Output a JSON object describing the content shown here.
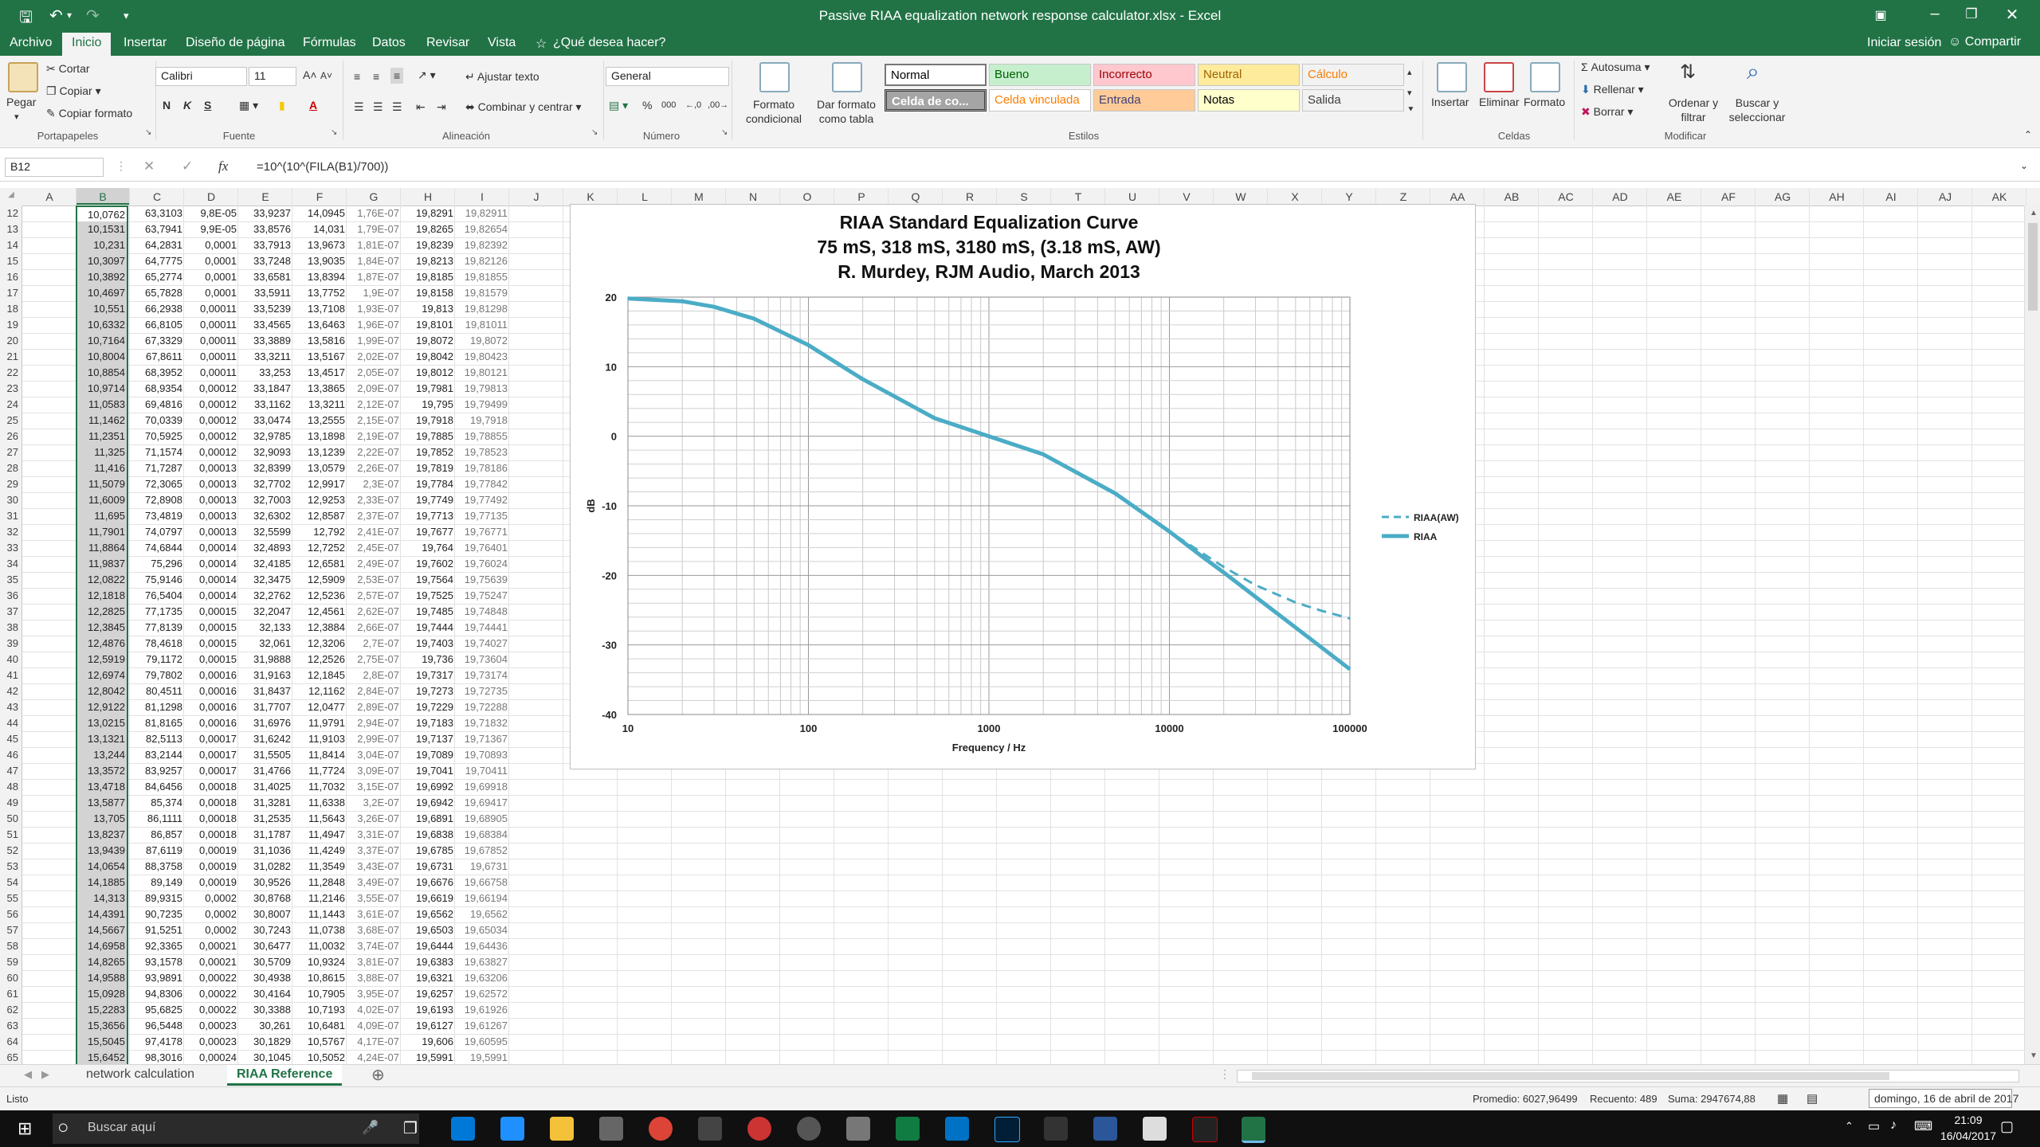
{
  "window": {
    "title": "Passive RIAA equalization network response calculator.xlsx - Excel"
  },
  "tabs": [
    "Archivo",
    "Inicio",
    "Insertar",
    "Diseño de página",
    "Fórmulas",
    "Datos",
    "Revisar",
    "Vista"
  ],
  "tell_me": "¿Qué desea hacer?",
  "account": {
    "signin": "Iniciar sesión",
    "share": "Compartir"
  },
  "ribbon": {
    "clipboard": {
      "paste": "Pegar",
      "cut": "Cortar",
      "copy": "Copiar",
      "format_painter": "Copiar formato",
      "group": "Portapapeles"
    },
    "font": {
      "name": "Calibri",
      "size": "11",
      "group": "Fuente"
    },
    "alignment": {
      "wrap": "Ajustar texto",
      "merge": "Combinar y centrar",
      "group": "Alineación"
    },
    "number": {
      "format": "General",
      "group": "Número"
    },
    "styles": {
      "cond_format": "Formato condicional",
      "as_table": "Dar formato como tabla",
      "group": "Estilos",
      "cells": [
        {
          "label": "Normal",
          "bg": "#ffffff",
          "fg": "#000000"
        },
        {
          "label": "Bueno",
          "bg": "#c6efce",
          "fg": "#006100"
        },
        {
          "label": "Incorrecto",
          "bg": "#ffc7ce",
          "fg": "#9c0006"
        },
        {
          "label": "Neutral",
          "bg": "#ffeb9c",
          "fg": "#9c6500"
        },
        {
          "label": "Cálculo",
          "bg": "#f2f2f2",
          "fg": "#fa7d00"
        },
        {
          "label": "Celda de co...",
          "bg": "#a5a5a5",
          "fg": "#ffffff"
        },
        {
          "label": "Celda vinculada",
          "bg": "#ffffff",
          "fg": "#fa7d00"
        },
        {
          "label": "Entrada",
          "bg": "#ffcc99",
          "fg": "#3f3f76"
        },
        {
          "label": "Notas",
          "bg": "#ffffcc",
          "fg": "#000000"
        },
        {
          "label": "Salida",
          "bg": "#f2f2f2",
          "fg": "#3f3f3f"
        }
      ]
    },
    "cells": {
      "insert": "Insertar",
      "delete": "Eliminar",
      "format": "Formato",
      "group": "Celdas"
    },
    "editing": {
      "autosum": "Autosuma",
      "fill": "Rellenar",
      "clear": "Borrar",
      "sort": "Ordenar y filtrar",
      "find": "Buscar y seleccionar",
      "group": "Modificar"
    }
  },
  "formula_bar": {
    "name_box": "B12",
    "fx": "fx",
    "formula": "=10^(10^(FILA(B1)/700))"
  },
  "columns": [
    "A",
    "B",
    "C",
    "D",
    "E",
    "F",
    "G",
    "H",
    "I",
    "J",
    "K",
    "L",
    "M",
    "N",
    "O",
    "P",
    "Q",
    "R",
    "S",
    "T",
    "U",
    "V",
    "W",
    "X",
    "Y",
    "Z",
    "AA",
    "AB",
    "AC",
    "AD",
    "AE",
    "AF",
    "AG",
    "AH",
    "AI",
    "AJ",
    "AK"
  ],
  "rows": [
    {
      "n": "12",
      "c": [
        "10,0762",
        "63,3103",
        "9,8E-05",
        "33,9237",
        "14,0945",
        "1,76E-07",
        "19,8291",
        "19,82911"
      ]
    },
    {
      "n": "13",
      "c": [
        "10,1531",
        "63,7941",
        "9,9E-05",
        "33,8576",
        "14,031",
        "1,79E-07",
        "19,8265",
        "19,82654"
      ]
    },
    {
      "n": "14",
      "c": [
        "10,231",
        "64,2831",
        "0,0001",
        "33,7913",
        "13,9673",
        "1,81E-07",
        "19,8239",
        "19,82392"
      ]
    },
    {
      "n": "15",
      "c": [
        "10,3097",
        "64,7775",
        "0,0001",
        "33,7248",
        "13,9035",
        "1,84E-07",
        "19,8213",
        "19,82126"
      ]
    },
    {
      "n": "16",
      "c": [
        "10,3892",
        "65,2774",
        "0,0001",
        "33,6581",
        "13,8394",
        "1,87E-07",
        "19,8185",
        "19,81855"
      ]
    },
    {
      "n": "17",
      "c": [
        "10,4697",
        "65,7828",
        "0,0001",
        "33,5911",
        "13,7752",
        "1,9E-07",
        "19,8158",
        "19,81579"
      ]
    },
    {
      "n": "18",
      "c": [
        "10,551",
        "66,2938",
        "0,00011",
        "33,5239",
        "13,7108",
        "1,93E-07",
        "19,813",
        "19,81298"
      ]
    },
    {
      "n": "19",
      "c": [
        "10,6332",
        "66,8105",
        "0,00011",
        "33,4565",
        "13,6463",
        "1,96E-07",
        "19,8101",
        "19,81011"
      ]
    },
    {
      "n": "20",
      "c": [
        "10,7164",
        "67,3329",
        "0,00011",
        "33,3889",
        "13,5816",
        "1,99E-07",
        "19,8072",
        "19,8072"
      ]
    },
    {
      "n": "21",
      "c": [
        "10,8004",
        "67,8611",
        "0,00011",
        "33,3211",
        "13,5167",
        "2,02E-07",
        "19,8042",
        "19,80423"
      ]
    },
    {
      "n": "22",
      "c": [
        "10,8854",
        "68,3952",
        "0,00011",
        "33,253",
        "13,4517",
        "2,05E-07",
        "19,8012",
        "19,80121"
      ]
    },
    {
      "n": "23",
      "c": [
        "10,9714",
        "68,9354",
        "0,00012",
        "33,1847",
        "13,3865",
        "2,09E-07",
        "19,7981",
        "19,79813"
      ]
    },
    {
      "n": "24",
      "c": [
        "11,0583",
        "69,4816",
        "0,00012",
        "33,1162",
        "13,3211",
        "2,12E-07",
        "19,795",
        "19,79499"
      ]
    },
    {
      "n": "25",
      "c": [
        "11,1462",
        "70,0339",
        "0,00012",
        "33,0474",
        "13,2555",
        "2,15E-07",
        "19,7918",
        "19,7918"
      ]
    },
    {
      "n": "26",
      "c": [
        "11,2351",
        "70,5925",
        "0,00012",
        "32,9785",
        "13,1898",
        "2,19E-07",
        "19,7885",
        "19,78855"
      ]
    },
    {
      "n": "27",
      "c": [
        "11,325",
        "71,1574",
        "0,00012",
        "32,9093",
        "13,1239",
        "2,22E-07",
        "19,7852",
        "19,78523"
      ]
    },
    {
      "n": "28",
      "c": [
        "11,416",
        "71,7287",
        "0,00013",
        "32,8399",
        "13,0579",
        "2,26E-07",
        "19,7819",
        "19,78186"
      ]
    },
    {
      "n": "29",
      "c": [
        "11,5079",
        "72,3065",
        "0,00013",
        "32,7702",
        "12,9917",
        "2,3E-07",
        "19,7784",
        "19,77842"
      ]
    },
    {
      "n": "30",
      "c": [
        "11,6009",
        "72,8908",
        "0,00013",
        "32,7003",
        "12,9253",
        "2,33E-07",
        "19,7749",
        "19,77492"
      ]
    },
    {
      "n": "31",
      "c": [
        "11,695",
        "73,4819",
        "0,00013",
        "32,6302",
        "12,8587",
        "2,37E-07",
        "19,7713",
        "19,77135"
      ]
    },
    {
      "n": "32",
      "c": [
        "11,7901",
        "74,0797",
        "0,00013",
        "32,5599",
        "12,792",
        "2,41E-07",
        "19,7677",
        "19,76771"
      ]
    },
    {
      "n": "33",
      "c": [
        "11,8864",
        "74,6844",
        "0,00014",
        "32,4893",
        "12,7252",
        "2,45E-07",
        "19,764",
        "19,76401"
      ]
    },
    {
      "n": "34",
      "c": [
        "11,9837",
        "75,296",
        "0,00014",
        "32,4185",
        "12,6581",
        "2,49E-07",
        "19,7602",
        "19,76024"
      ]
    },
    {
      "n": "35",
      "c": [
        "12,0822",
        "75,9146",
        "0,00014",
        "32,3475",
        "12,5909",
        "2,53E-07",
        "19,7564",
        "19,75639"
      ]
    },
    {
      "n": "36",
      "c": [
        "12,1818",
        "76,5404",
        "0,00014",
        "32,2762",
        "12,5236",
        "2,57E-07",
        "19,7525",
        "19,75247"
      ]
    },
    {
      "n": "37",
      "c": [
        "12,2825",
        "77,1735",
        "0,00015",
        "32,2047",
        "12,4561",
        "2,62E-07",
        "19,7485",
        "19,74848"
      ]
    },
    {
      "n": "38",
      "c": [
        "12,3845",
        "77,8139",
        "0,00015",
        "32,133",
        "12,3884",
        "2,66E-07",
        "19,7444",
        "19,74441"
      ]
    },
    {
      "n": "39",
      "c": [
        "12,4876",
        "78,4618",
        "0,00015",
        "32,061",
        "12,3206",
        "2,7E-07",
        "19,7403",
        "19,74027"
      ]
    },
    {
      "n": "40",
      "c": [
        "12,5919",
        "79,1172",
        "0,00015",
        "31,9888",
        "12,2526",
        "2,75E-07",
        "19,736",
        "19,73604"
      ]
    },
    {
      "n": "41",
      "c": [
        "12,6974",
        "79,7802",
        "0,00016",
        "31,9163",
        "12,1845",
        "2,8E-07",
        "19,7317",
        "19,73174"
      ]
    },
    {
      "n": "42",
      "c": [
        "12,8042",
        "80,4511",
        "0,00016",
        "31,8437",
        "12,1162",
        "2,84E-07",
        "19,7273",
        "19,72735"
      ]
    },
    {
      "n": "43",
      "c": [
        "12,9122",
        "81,1298",
        "0,00016",
        "31,7707",
        "12,0477",
        "2,89E-07",
        "19,7229",
        "19,72288"
      ]
    },
    {
      "n": "44",
      "c": [
        "13,0215",
        "81,8165",
        "0,00016",
        "31,6976",
        "11,9791",
        "2,94E-07",
        "19,7183",
        "19,71832"
      ]
    },
    {
      "n": "45",
      "c": [
        "13,1321",
        "82,5113",
        "0,00017",
        "31,6242",
        "11,9103",
        "2,99E-07",
        "19,7137",
        "19,71367"
      ]
    },
    {
      "n": "46",
      "c": [
        "13,244",
        "83,2144",
        "0,00017",
        "31,5505",
        "11,8414",
        "3,04E-07",
        "19,7089",
        "19,70893"
      ]
    },
    {
      "n": "47",
      "c": [
        "13,3572",
        "83,9257",
        "0,00017",
        "31,4766",
        "11,7724",
        "3,09E-07",
        "19,7041",
        "19,70411"
      ]
    },
    {
      "n": "48",
      "c": [
        "13,4718",
        "84,6456",
        "0,00018",
        "31,4025",
        "11,7032",
        "3,15E-07",
        "19,6992",
        "19,69918"
      ]
    },
    {
      "n": "49",
      "c": [
        "13,5877",
        "85,374",
        "0,00018",
        "31,3281",
        "11,6338",
        "3,2E-07",
        "19,6942",
        "19,69417"
      ]
    },
    {
      "n": "50",
      "c": [
        "13,705",
        "86,1111",
        "0,00018",
        "31,2535",
        "11,5643",
        "3,26E-07",
        "19,6891",
        "19,68905"
      ]
    },
    {
      "n": "51",
      "c": [
        "13,8237",
        "86,857",
        "0,00018",
        "31,1787",
        "11,4947",
        "3,31E-07",
        "19,6838",
        "19,68384"
      ]
    },
    {
      "n": "52",
      "c": [
        "13,9439",
        "87,6119",
        "0,00019",
        "31,1036",
        "11,4249",
        "3,37E-07",
        "19,6785",
        "19,67852"
      ]
    },
    {
      "n": "53",
      "c": [
        "14,0654",
        "88,3758",
        "0,00019",
        "31,0282",
        "11,3549",
        "3,43E-07",
        "19,6731",
        "19,6731"
      ]
    },
    {
      "n": "54",
      "c": [
        "14,1885",
        "89,149",
        "0,00019",
        "30,9526",
        "11,2848",
        "3,49E-07",
        "19,6676",
        "19,66758"
      ]
    },
    {
      "n": "55",
      "c": [
        "14,313",
        "89,9315",
        "0,0002",
        "30,8768",
        "11,2146",
        "3,55E-07",
        "19,6619",
        "19,66194"
      ]
    },
    {
      "n": "56",
      "c": [
        "14,4391",
        "90,7235",
        "0,0002",
        "30,8007",
        "11,1443",
        "3,61E-07",
        "19,6562",
        "19,6562"
      ]
    },
    {
      "n": "57",
      "c": [
        "14,5667",
        "91,5251",
        "0,0002",
        "30,7243",
        "11,0738",
        "3,68E-07",
        "19,6503",
        "19,65034"
      ]
    },
    {
      "n": "58",
      "c": [
        "14,6958",
        "92,3365",
        "0,00021",
        "30,6477",
        "11,0032",
        "3,74E-07",
        "19,6444",
        "19,64436"
      ]
    },
    {
      "n": "59",
      "c": [
        "14,8265",
        "93,1578",
        "0,00021",
        "30,5709",
        "10,9324",
        "3,81E-07",
        "19,6383",
        "19,63827"
      ]
    },
    {
      "n": "60",
      "c": [
        "14,9588",
        "93,9891",
        "0,00022",
        "30,4938",
        "10,8615",
        "3,88E-07",
        "19,6321",
        "19,63206"
      ]
    },
    {
      "n": "61",
      "c": [
        "15,0928",
        "94,8306",
        "0,00022",
        "30,4164",
        "10,7905",
        "3,95E-07",
        "19,6257",
        "19,62572"
      ]
    },
    {
      "n": "62",
      "c": [
        "15,2283",
        "95,6825",
        "0,00022",
        "30,3388",
        "10,7193",
        "4,02E-07",
        "19,6193",
        "19,61926"
      ]
    },
    {
      "n": "63",
      "c": [
        "15,3656",
        "96,5448",
        "0,00023",
        "30,261",
        "10,6481",
        "4,09E-07",
        "19,6127",
        "19,61267"
      ]
    },
    {
      "n": "64",
      "c": [
        "15,5045",
        "97,4178",
        "0,00023",
        "30,1829",
        "10,5767",
        "4,17E-07",
        "19,606",
        "19,60595"
      ]
    },
    {
      "n": "65",
      "c": [
        "15,6452",
        "98,3016",
        "0,00024",
        "30,1045",
        "10,5052",
        "4,24E-07",
        "19,5991",
        "19,5991"
      ]
    }
  ],
  "chart_data": {
    "type": "line",
    "title": "RIAA Standard Equalization Curve",
    "subtitle_lines": [
      "75 mS, 318 mS, 3180 mS, (3.18 mS, AW)",
      "R. Murdey, RJM Audio, March 2013"
    ],
    "xlabel": "Frequency / Hz",
    "ylabel": "dB",
    "x_scale": "log",
    "xlim": [
      10,
      100000
    ],
    "ylim": [
      -40,
      20
    ],
    "x_ticks": [
      "10",
      "100",
      "1000",
      "10000",
      "100000"
    ],
    "y_ticks": [
      "20",
      "10",
      "0",
      "-10",
      "-20",
      "-30",
      "-40"
    ],
    "grid": true,
    "legend_position": "right",
    "series": [
      {
        "name": "RIAA(AW)",
        "style": "dashed",
        "color": "#4bacc6",
        "x": [
          10,
          20,
          30,
          50,
          100,
          200,
          500,
          1000,
          2000,
          5000,
          10000,
          15000,
          20000,
          30000,
          50000,
          70000,
          100000
        ],
        "y": [
          19.8,
          19.4,
          18.6,
          16.9,
          13.1,
          8.2,
          2.6,
          0.0,
          -2.6,
          -8.2,
          -13.7,
          -16.7,
          -18.8,
          -21.4,
          -23.9,
          -25.1,
          -26.2
        ]
      },
      {
        "name": "RIAA",
        "style": "solid",
        "color": "#4bacc6",
        "x": [
          10,
          20,
          30,
          50,
          100,
          200,
          500,
          1000,
          2000,
          5000,
          10000,
          15000,
          20000,
          30000,
          50000,
          70000,
          100000
        ],
        "y": [
          19.8,
          19.4,
          18.6,
          16.9,
          13.1,
          8.2,
          2.6,
          0.0,
          -2.6,
          -8.2,
          -13.7,
          -17.2,
          -19.6,
          -23.1,
          -27.5,
          -30.4,
          -33.5
        ]
      }
    ]
  },
  "sheets": [
    {
      "name": "network calculation",
      "active": false
    },
    {
      "name": "RIAA Reference",
      "active": true
    }
  ],
  "status": {
    "mode": "Listo",
    "average": "Promedio: 6027,96499",
    "count": "Recuento: 489",
    "sum": "Suma: 2947674,88",
    "date_tip": "domingo, 16 de abril de 2017"
  },
  "taskbar": {
    "search": "Buscar aquí",
    "time": "21:09",
    "date": "16/04/2017"
  }
}
